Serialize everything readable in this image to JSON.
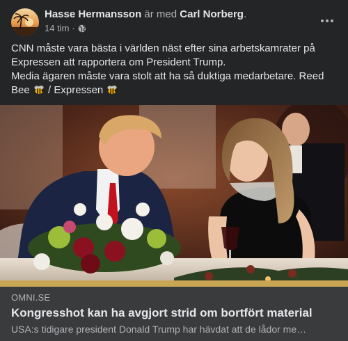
{
  "post": {
    "author": "Hasse Hermansson",
    "with_text": "är med",
    "tagged": "Carl Norberg",
    "tagged_suffix": ".",
    "time": "14 tim",
    "separator": "·",
    "privacy_icon": "globe-icon",
    "more_icon": "ellipsis-icon",
    "text_line1": "CNN måste vara bästa i världen näst efter sina arbetskamrater på Expressen att rapportera om President Trump.",
    "text_line2_part1": "Media ägaren måste vara stolt att ha så duktiga medarbetare. Reed Bee",
    "text_line2_part2": "/ Expressen",
    "emoji_icon": "bee-emoji-icon"
  },
  "link_preview": {
    "domain": "OMNI.SE",
    "title": "Kongresshot kan ha avgjort strid om bortfört material",
    "description": "USA:s tidigare president Donald Trump har hävdat att de lådor me…"
  },
  "colors": {
    "background": "#242526",
    "link_box": "#3a3b3c",
    "primary_text": "#e4e6eb",
    "secondary_text": "#b0b3b8"
  }
}
